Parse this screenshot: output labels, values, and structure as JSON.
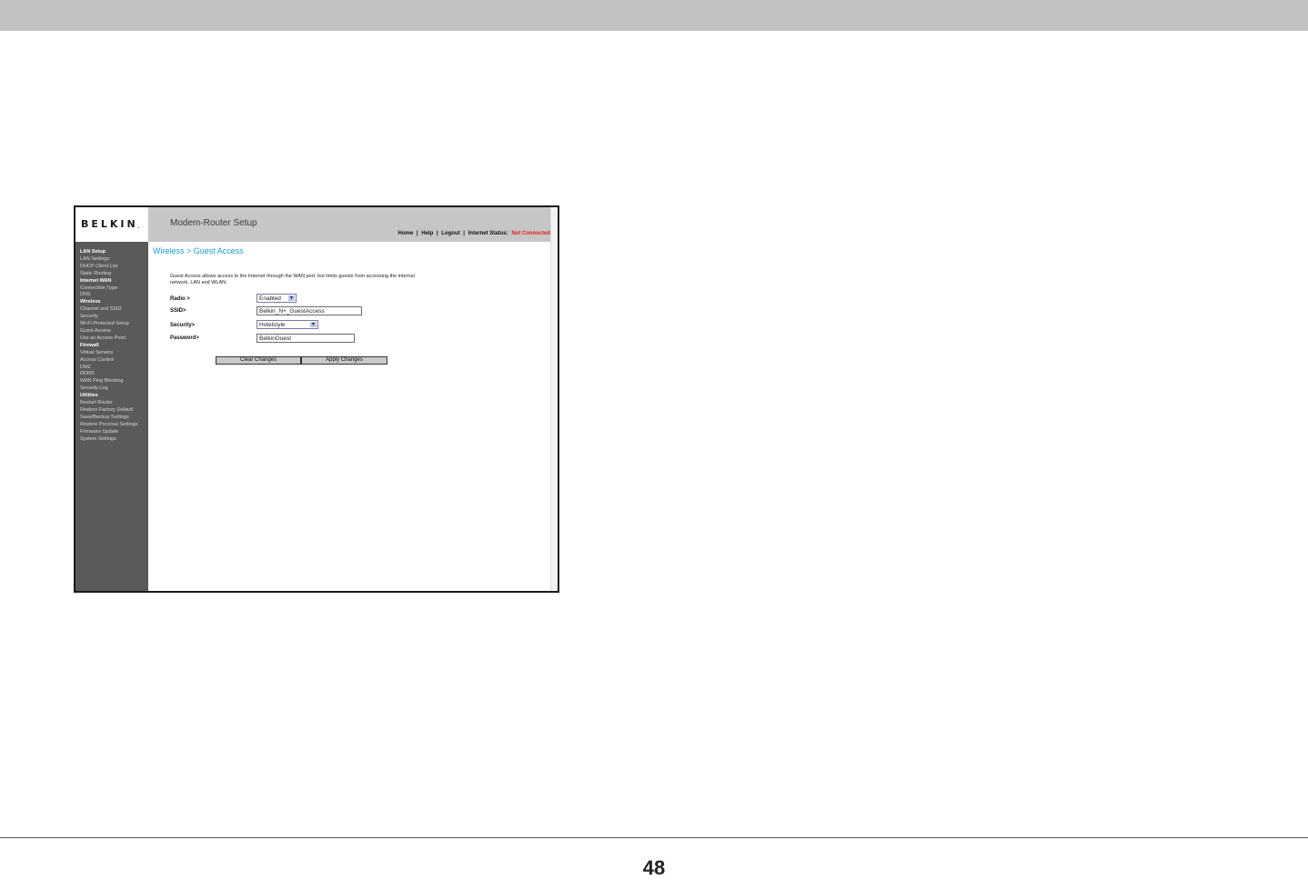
{
  "document": {
    "page_number": "48"
  },
  "router_ui": {
    "logo": "BELKIN",
    "logo_mark": ".",
    "app_title": "Modem-Router Setup",
    "top_nav": {
      "home": "Home",
      "sep": "|",
      "help": "Help",
      "logout": "Logout",
      "status_label": "Internet Status:",
      "status_value": "Not Connected"
    },
    "sidebar": {
      "lan_setup": "LAN Setup",
      "lan_settings": "LAN Settings",
      "dhcp_client_list": "DHCP Client List",
      "static_routing": "Static Routing",
      "internet_wan": "Internet WAN",
      "connection_type": "Connection Type",
      "dns": "DNS",
      "wireless": "Wireless",
      "channel_ssid": "Channel and SSID",
      "security": "Security",
      "wps": "Wi-Fi Protected Setup",
      "guest_access": "Guest Access",
      "use_as_access_point": "Use as Access Point",
      "firewall": "Firewall",
      "virtual_servers": "Virtual Servers",
      "access_control": "Access Control",
      "dmz": "DMZ",
      "ddns": "DDNS",
      "wan_ping_blocking": "WAN Ping Blocking",
      "security_log": "Security Log",
      "utilities": "Utilities",
      "restart_router": "Restart Router",
      "restore_factory_default": "Restore Factory Default",
      "save_backup_settings": "Save/Backup Settings",
      "restore_previous_settings": "Restore Previous Settings",
      "firmware_update": "Firmware Update",
      "system_settings": "System Settings"
    },
    "breadcrumb": "Wireless > Guest Access",
    "description": "Guest Access allows access to the Internet through the WAN port, but limits guests from accessing the internal network, LAN and WLAN.",
    "form": {
      "radio_label": "Radio >",
      "radio_value": "Enabled",
      "ssid_label": "SSID>",
      "ssid_value": "Belkin_N+_GuestAccess",
      "security_label": "Security>",
      "security_value": "Hotelstyle",
      "password_label": "Password>",
      "password_value": "BelkinGuest"
    },
    "buttons": {
      "clear": "Clear Changes",
      "apply": "Apply Changes"
    },
    "colors": {
      "heading": "#1a9ad6",
      "status_alert": "#e0201c",
      "sidebar_bg": "#5a5a5a",
      "header_bg": "#c6c6c6"
    }
  }
}
